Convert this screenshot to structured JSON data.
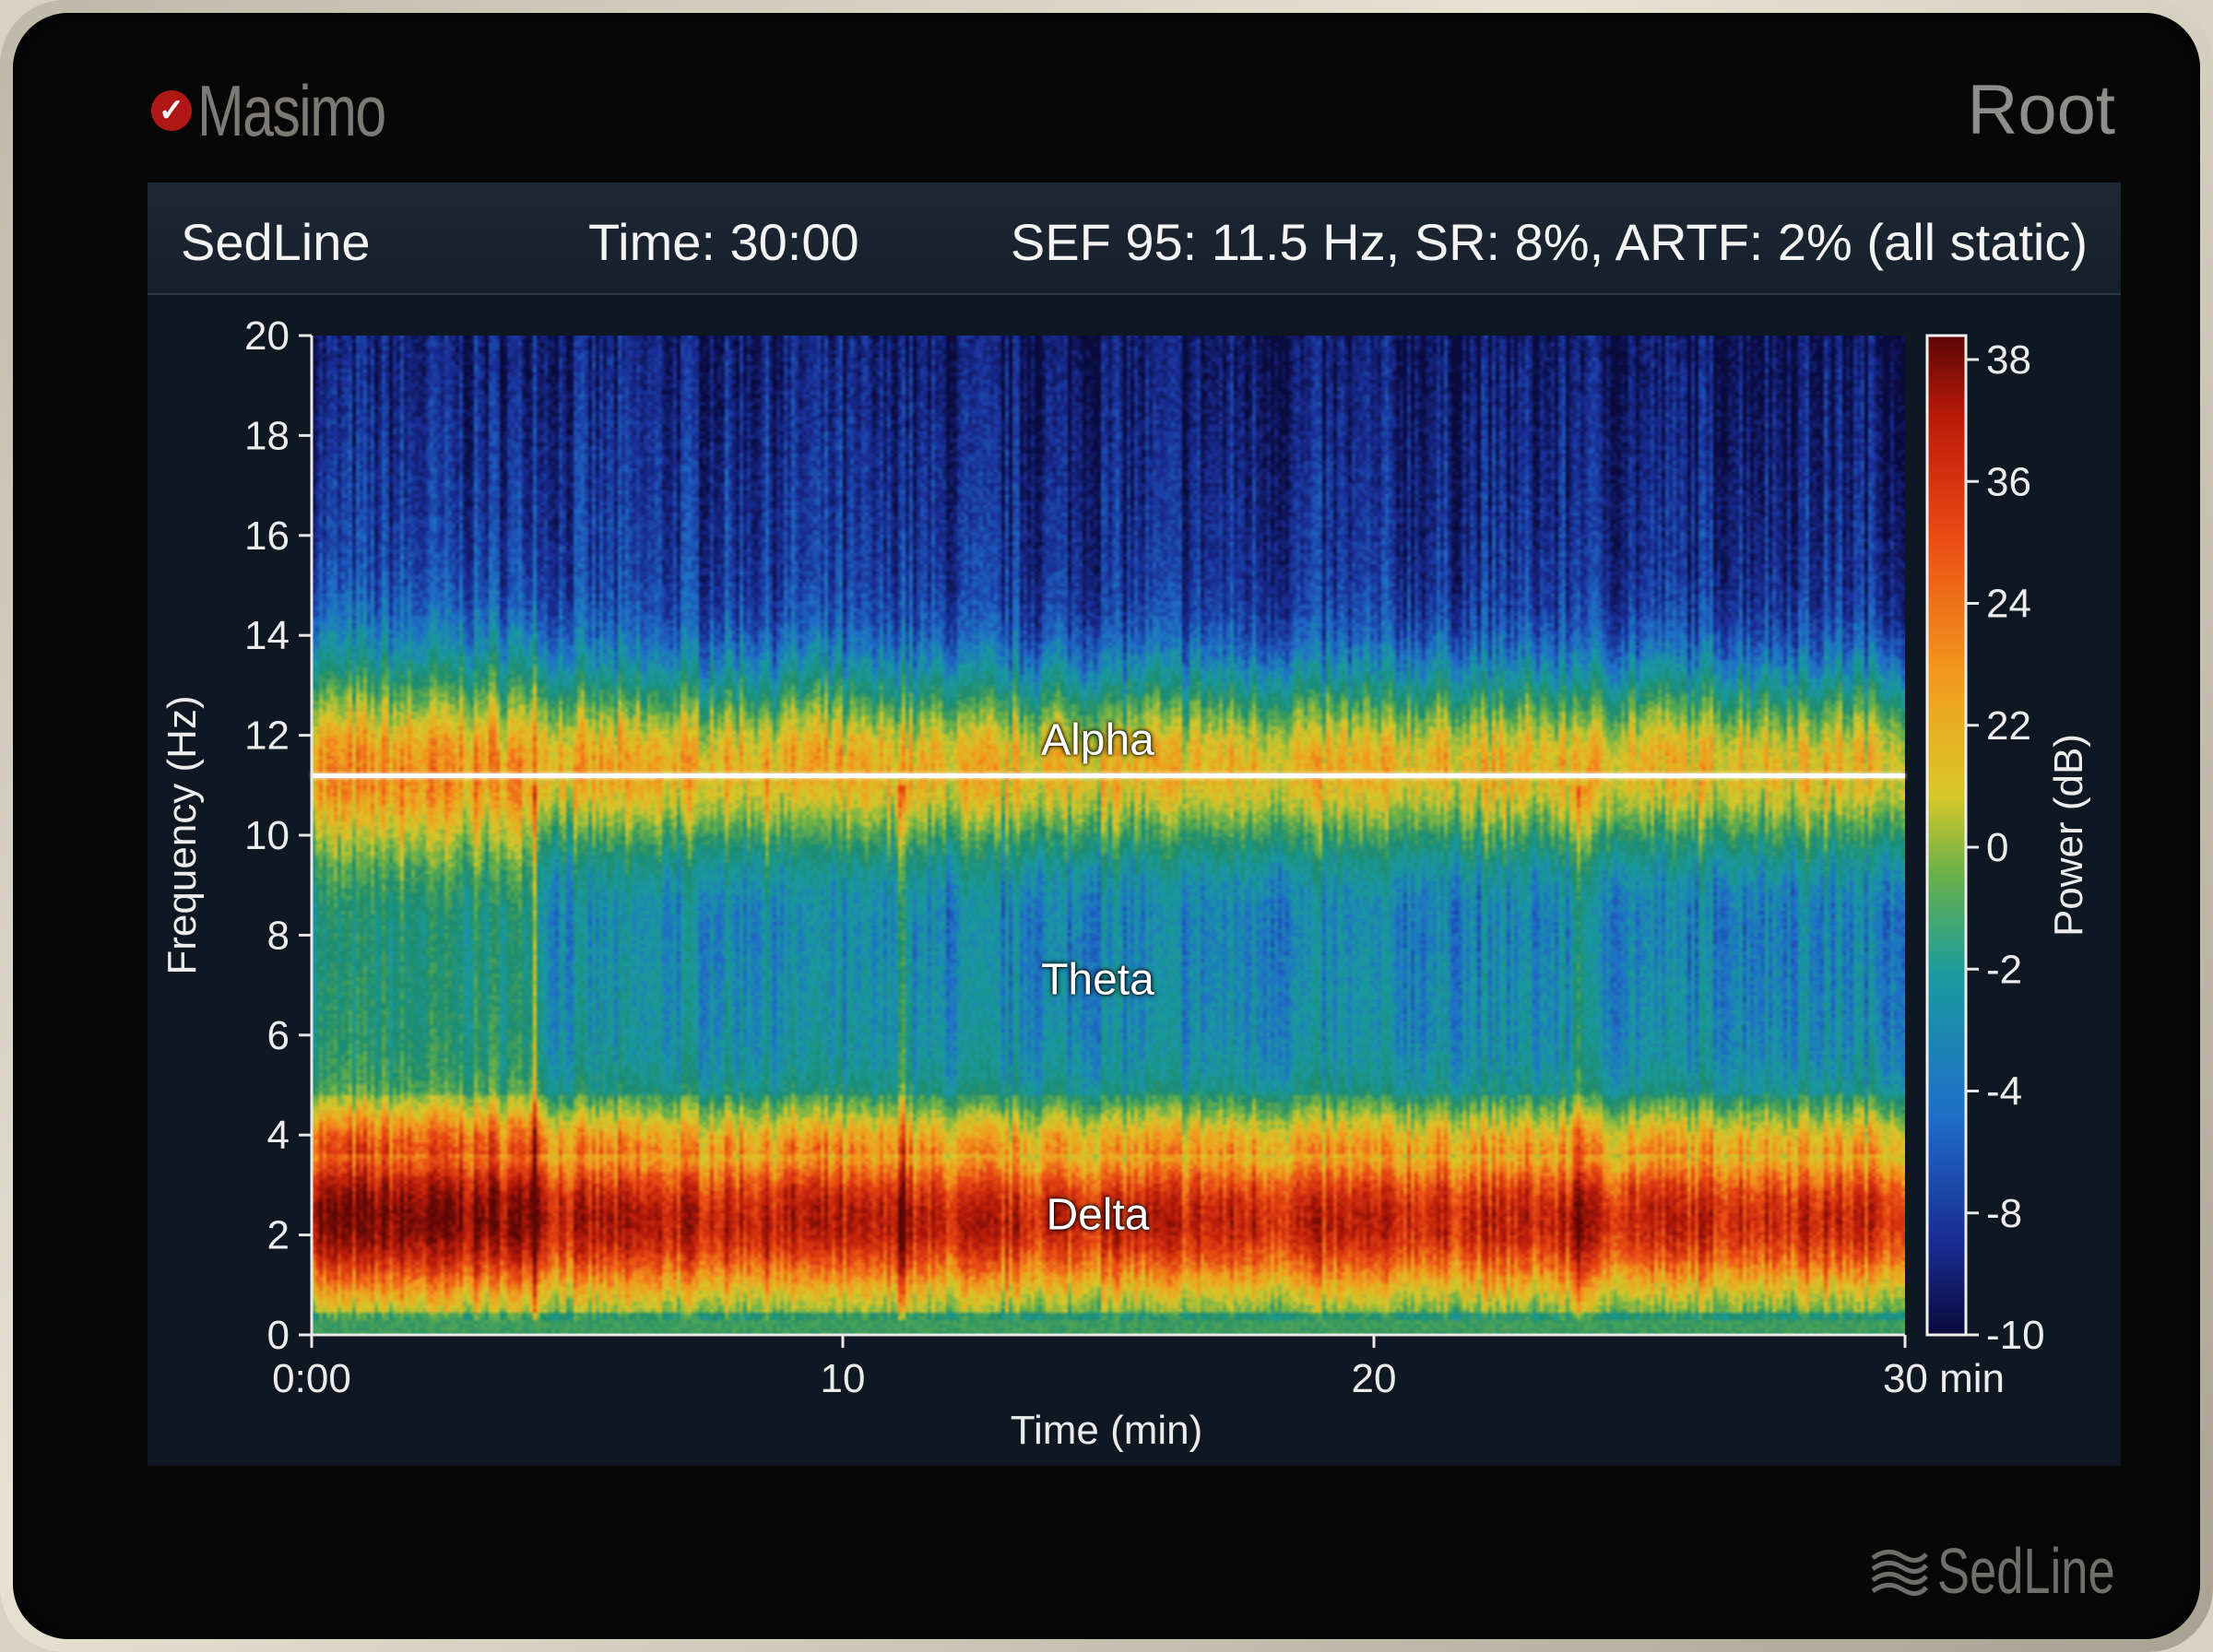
{
  "device": {
    "brand": "Masimo",
    "model": "Root",
    "module": "SedLine"
  },
  "header": {
    "app_title": "SedLine",
    "time_readout": "Time: 30:00",
    "metrics_readout": "SEF 95: 11.5 Hz, SR: 8%, ARTF: 2% (all static)"
  },
  "chart_data": {
    "type": "heatmap",
    "xlabel": "Time (min)",
    "ylabel": "Frequency (Hz)",
    "colorbar_label": "Power (dB)",
    "xlim": [
      0,
      30
    ],
    "ylim": [
      0,
      20
    ],
    "x_ticks": [
      {
        "value": 0,
        "label": "0:00"
      },
      {
        "value": 10,
        "label": "10"
      },
      {
        "value": 20,
        "label": "20"
      },
      {
        "value": 30,
        "label": "30 min"
      }
    ],
    "y_ticks": [
      {
        "value": 0,
        "label": "0"
      },
      {
        "value": 2,
        "label": "2"
      },
      {
        "value": 4,
        "label": "4"
      },
      {
        "value": 6,
        "label": "6"
      },
      {
        "value": 8,
        "label": "8"
      },
      {
        "value": 10,
        "label": "10"
      },
      {
        "value": 12,
        "label": "12"
      },
      {
        "value": 14,
        "label": "14"
      },
      {
        "value": 16,
        "label": "16"
      },
      {
        "value": 18,
        "label": "18"
      },
      {
        "value": 20,
        "label": "20"
      }
    ],
    "colorbar_ticks": [
      "38",
      "36",
      "24",
      "22",
      "0",
      "-2",
      "-4",
      "-8",
      "-10"
    ],
    "sef95_hz": 11.2,
    "bands": [
      {
        "name": "Alpha",
        "label_freq": 11.9,
        "label_time": 14.8,
        "range_hz": [
          8.5,
          13.5
        ]
      },
      {
        "name": "Theta",
        "label_freq": 7.1,
        "label_time": 14.8,
        "range_hz": [
          4.5,
          8.5
        ]
      },
      {
        "name": "Delta",
        "label_freq": 2.4,
        "label_time": 14.8,
        "range_hz": [
          0.3,
          4.5
        ]
      }
    ],
    "event_times_min": [
      4.2,
      11.1,
      23.9
    ],
    "grid": false,
    "colormap": [
      "#0a0a3c",
      "#1a2f99",
      "#1f6ec8",
      "#1a9aa0",
      "#1d8c6e",
      "#68b04a",
      "#d8c82a",
      "#f29a1e",
      "#ea4a14",
      "#b81a0a",
      "#5c0704"
    ]
  }
}
